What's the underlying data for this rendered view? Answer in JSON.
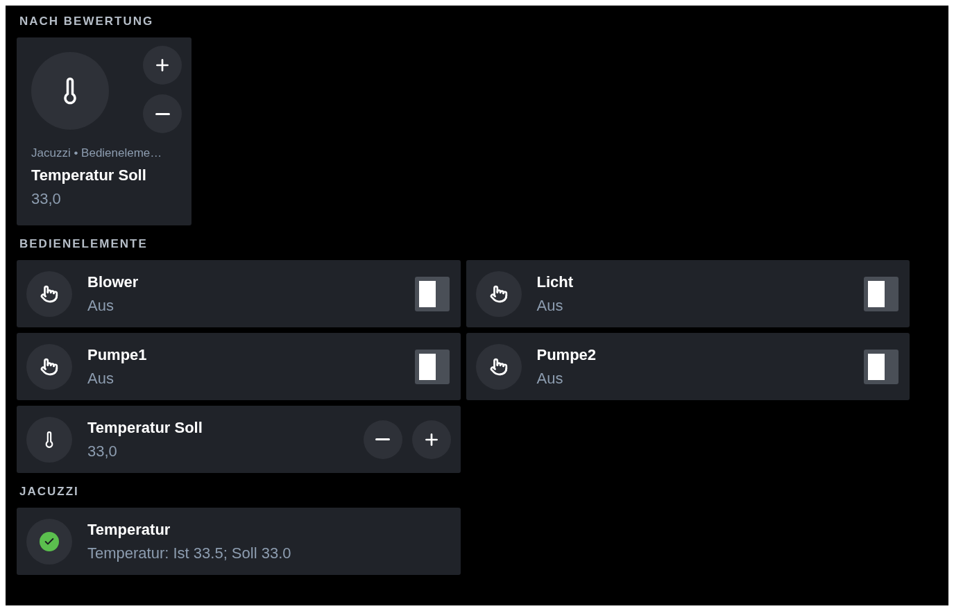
{
  "sections": [
    {
      "heading": "NACH BEWERTUNG",
      "kind": "tiles",
      "items": [
        {
          "kind": "stepper",
          "breadcrumb": "Jacuzzi • Bedieneleme…",
          "name": "Temperatur Soll",
          "value": "33,0"
        }
      ]
    },
    {
      "heading": "BEDIENELEMENTE",
      "kind": "rows",
      "items": [
        {
          "kind": "switch",
          "name": "Blower",
          "value": "Aus",
          "on": false
        },
        {
          "kind": "switch",
          "name": "Licht",
          "value": "Aus",
          "on": false
        },
        {
          "kind": "switch",
          "name": "Pumpe1",
          "value": "Aus",
          "on": false
        },
        {
          "kind": "switch",
          "name": "Pumpe2",
          "value": "Aus",
          "on": false
        },
        {
          "kind": "stepper",
          "name": "Temperatur Soll",
          "value": "33,0"
        }
      ]
    },
    {
      "heading": "JACUZZI",
      "kind": "rows",
      "items": [
        {
          "kind": "status",
          "name": "Temperatur",
          "value": "Temperatur: Ist 33.5; Soll 33.0",
          "ok": true
        }
      ]
    }
  ]
}
